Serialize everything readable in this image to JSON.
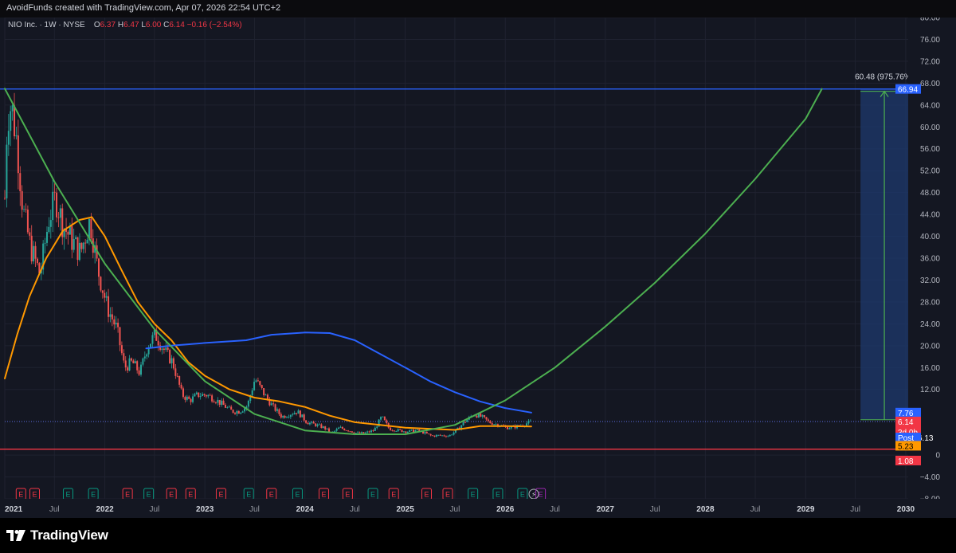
{
  "header": {
    "attribution": "AvoidFunds created with TradingView.com, Apr 07, 2026 22:54 UTC+2"
  },
  "legend": {
    "symbol": "NIO Inc. · 1W · NYSE",
    "open_label": "O",
    "open": "6.37",
    "high_label": "H",
    "high": "6.47",
    "low_label": "L",
    "low": "6.00",
    "close_label": "C",
    "close": "6.14",
    "change": "−0.16 (−2.54%)"
  },
  "footer": {
    "brand": "TradingView"
  },
  "colors": {
    "background": "#141722",
    "grid": "#1f2230",
    "candle_up": "#26a69a",
    "candle_down": "#ef5350",
    "ma_orange": "#ff9800",
    "ma_blue": "#2962ff",
    "parabola_green": "#4caf50",
    "level_blue": "#2962ff",
    "level_red": "#f23645",
    "projection_box": "#1e3a6e",
    "earnings_red": "#f23645",
    "earnings_green": "#089981",
    "upcoming_purple": "#9c27b0"
  },
  "chart_data": {
    "type": "candlestick",
    "symbol": "NIO Inc.",
    "interval": "1W",
    "exchange": "NYSE",
    "y_axis": {
      "min": -8,
      "max": 80,
      "ticks": [
        "80.00",
        "76.00",
        "72.00",
        "68.00",
        "64.00",
        "60.00",
        "56.00",
        "52.00",
        "48.00",
        "44.00",
        "40.00",
        "36.00",
        "32.00",
        "28.00",
        "24.00",
        "20.00",
        "16.00",
        "12.00",
        "0",
        "−4.00",
        "−8.00"
      ]
    },
    "x_axis": {
      "range": [
        "2021-01-01",
        "2030-01-10"
      ],
      "ticks": [
        {
          "label": "2021",
          "date": "2021-01-01",
          "bold": true
        },
        {
          "label": "Jul",
          "date": "2021-07-01",
          "bold": false
        },
        {
          "label": "2022",
          "date": "2022-01-01",
          "bold": true
        },
        {
          "label": "Jul",
          "date": "2022-07-01",
          "bold": false
        },
        {
          "label": "2023",
          "date": "2023-01-01",
          "bold": true
        },
        {
          "label": "Jul",
          "date": "2023-07-01",
          "bold": false
        },
        {
          "label": "2024",
          "date": "2024-01-01",
          "bold": true
        },
        {
          "label": "Jul",
          "date": "2024-07-01",
          "bold": false
        },
        {
          "label": "2025",
          "date": "2025-01-01",
          "bold": true
        },
        {
          "label": "Jul",
          "date": "2025-07-01",
          "bold": false
        },
        {
          "label": "2026",
          "date": "2026-01-01",
          "bold": true
        },
        {
          "label": "Jul",
          "date": "2026-07-01",
          "bold": false
        },
        {
          "label": "2027",
          "date": "2027-01-01",
          "bold": true
        },
        {
          "label": "Jul",
          "date": "2027-07-01",
          "bold": false
        },
        {
          "label": "2028",
          "date": "2028-01-01",
          "bold": true
        },
        {
          "label": "Jul",
          "date": "2028-07-01",
          "bold": false
        },
        {
          "label": "2029",
          "date": "2029-01-01",
          "bold": true
        },
        {
          "label": "Jul",
          "date": "2029-07-01",
          "bold": false
        },
        {
          "label": "2030",
          "date": "2030-01-01",
          "bold": true
        }
      ]
    },
    "price_path": [
      {
        "date": "2021-01-01",
        "price": 47
      },
      {
        "date": "2021-01-10",
        "price": 62
      },
      {
        "date": "2021-01-25",
        "price": 64
      },
      {
        "date": "2021-02-15",
        "price": 57
      },
      {
        "date": "2021-03-08",
        "price": 45
      },
      {
        "date": "2021-04-05",
        "price": 38
      },
      {
        "date": "2021-05-10",
        "price": 33
      },
      {
        "date": "2021-06-10",
        "price": 43
      },
      {
        "date": "2021-07-05",
        "price": 47
      },
      {
        "date": "2021-08-02",
        "price": 42
      },
      {
        "date": "2021-09-06",
        "price": 39
      },
      {
        "date": "2021-10-04",
        "price": 37
      },
      {
        "date": "2021-11-08",
        "price": 43
      },
      {
        "date": "2021-12-06",
        "price": 34
      },
      {
        "date": "2022-01-10",
        "price": 27
      },
      {
        "date": "2022-02-14",
        "price": 23
      },
      {
        "date": "2022-03-14",
        "price": 16
      },
      {
        "date": "2022-04-11",
        "price": 17
      },
      {
        "date": "2022-05-09",
        "price": 15
      },
      {
        "date": "2022-06-06",
        "price": 20
      },
      {
        "date": "2022-07-04",
        "price": 22
      },
      {
        "date": "2022-08-08",
        "price": 19
      },
      {
        "date": "2022-09-05",
        "price": 17
      },
      {
        "date": "2022-10-10",
        "price": 11
      },
      {
        "date": "2022-11-07",
        "price": 10
      },
      {
        "date": "2022-12-05",
        "price": 11
      },
      {
        "date": "2023-01-09",
        "price": 11
      },
      {
        "date": "2023-02-13",
        "price": 10
      },
      {
        "date": "2023-03-13",
        "price": 9
      },
      {
        "date": "2023-04-10",
        "price": 8
      },
      {
        "date": "2023-05-08",
        "price": 8
      },
      {
        "date": "2023-06-05",
        "price": 9
      },
      {
        "date": "2023-07-03",
        "price": 14
      },
      {
        "date": "2023-08-07",
        "price": 11
      },
      {
        "date": "2023-09-04",
        "price": 9
      },
      {
        "date": "2023-10-09",
        "price": 7
      },
      {
        "date": "2023-11-06",
        "price": 7.5
      },
      {
        "date": "2023-12-04",
        "price": 8
      },
      {
        "date": "2024-01-08",
        "price": 6
      },
      {
        "date": "2024-02-12",
        "price": 5.5
      },
      {
        "date": "2024-03-11",
        "price": 5
      },
      {
        "date": "2024-04-08",
        "price": 4
      },
      {
        "date": "2024-05-06",
        "price": 5
      },
      {
        "date": "2024-06-10",
        "price": 4.5
      },
      {
        "date": "2024-07-08",
        "price": 4
      },
      {
        "date": "2024-08-05",
        "price": 4
      },
      {
        "date": "2024-09-09",
        "price": 4.5
      },
      {
        "date": "2024-10-07",
        "price": 7
      },
      {
        "date": "2024-11-04",
        "price": 4.8
      },
      {
        "date": "2024-12-09",
        "price": 4.5
      },
      {
        "date": "2025-01-06",
        "price": 4.3
      },
      {
        "date": "2025-02-10",
        "price": 4.5
      },
      {
        "date": "2025-03-10",
        "price": 4.1
      },
      {
        "date": "2025-04-07",
        "price": 3.5
      },
      {
        "date": "2025-05-05",
        "price": 3.6
      },
      {
        "date": "2025-06-09",
        "price": 3.5
      },
      {
        "date": "2025-07-07",
        "price": 4.5
      },
      {
        "date": "2025-08-04",
        "price": 6
      },
      {
        "date": "2025-09-08",
        "price": 7.5
      },
      {
        "date": "2025-10-06",
        "price": 7
      },
      {
        "date": "2025-11-03",
        "price": 6
      },
      {
        "date": "2025-12-08",
        "price": 5.5
      },
      {
        "date": "2026-01-05",
        "price": 5
      },
      {
        "date": "2026-02-09",
        "price": 5.2
      },
      {
        "date": "2026-03-09",
        "price": 5.6
      },
      {
        "date": "2026-04-06",
        "price": 6.14
      }
    ],
    "series": [
      {
        "name": "",
        "color_key": "ma_orange",
        "points": [
          {
            "date": "2021-01-01",
            "price": 14
          },
          {
            "date": "2021-02-15",
            "price": 22
          },
          {
            "date": "2021-04-01",
            "price": 29
          },
          {
            "date": "2021-06-01",
            "price": 36
          },
          {
            "date": "2021-08-01",
            "price": 41
          },
          {
            "date": "2021-10-01",
            "price": 43
          },
          {
            "date": "2021-11-15",
            "price": 43.5
          },
          {
            "date": "2022-01-01",
            "price": 40
          },
          {
            "date": "2022-03-01",
            "price": 34
          },
          {
            "date": "2022-05-01",
            "price": 28
          },
          {
            "date": "2022-07-01",
            "price": 24
          },
          {
            "date": "2022-09-01",
            "price": 21
          },
          {
            "date": "2022-11-01",
            "price": 17
          },
          {
            "date": "2023-01-01",
            "price": 14.5
          },
          {
            "date": "2023-04-01",
            "price": 12
          },
          {
            "date": "2023-07-01",
            "price": 10.5
          },
          {
            "date": "2023-10-01",
            "price": 9.8
          },
          {
            "date": "2024-01-01",
            "price": 8.8
          },
          {
            "date": "2024-04-01",
            "price": 7.2
          },
          {
            "date": "2024-07-01",
            "price": 6
          },
          {
            "date": "2024-10-01",
            "price": 5.5
          },
          {
            "date": "2025-01-01",
            "price": 5
          },
          {
            "date": "2025-04-01",
            "price": 4.8
          },
          {
            "date": "2025-07-01",
            "price": 4.6
          },
          {
            "date": "2025-10-01",
            "price": 5.3
          },
          {
            "date": "2026-01-01",
            "price": 5.3
          },
          {
            "date": "2026-04-06",
            "price": 5.23
          }
        ]
      },
      {
        "name": "",
        "color_key": "ma_blue",
        "points": [
          {
            "date": "2022-06-01",
            "price": 19.5
          },
          {
            "date": "2022-09-01",
            "price": 20
          },
          {
            "date": "2023-01-01",
            "price": 20.5
          },
          {
            "date": "2023-06-01",
            "price": 21
          },
          {
            "date": "2023-09-01",
            "price": 22
          },
          {
            "date": "2024-01-01",
            "price": 22.4
          },
          {
            "date": "2024-04-01",
            "price": 22.3
          },
          {
            "date": "2024-07-01",
            "price": 21
          },
          {
            "date": "2024-10-01",
            "price": 18.5
          },
          {
            "date": "2025-01-01",
            "price": 16
          },
          {
            "date": "2025-04-01",
            "price": 13.5
          },
          {
            "date": "2025-07-01",
            "price": 11.5
          },
          {
            "date": "2025-10-01",
            "price": 9.8
          },
          {
            "date": "2026-01-01",
            "price": 8.6
          },
          {
            "date": "2026-04-06",
            "price": 7.76
          }
        ]
      },
      {
        "name": "",
        "color_key": "parabola_green",
        "points": [
          {
            "date": "2021-01-01",
            "price": 67
          },
          {
            "date": "2021-07-01",
            "price": 50
          },
          {
            "date": "2022-01-01",
            "price": 35
          },
          {
            "date": "2022-07-01",
            "price": 23
          },
          {
            "date": "2023-01-01",
            "price": 13.5
          },
          {
            "date": "2023-07-01",
            "price": 7.5
          },
          {
            "date": "2024-01-01",
            "price": 4.5
          },
          {
            "date": "2024-07-01",
            "price": 3.8
          },
          {
            "date": "2025-01-01",
            "price": 3.8
          },
          {
            "date": "2025-07-01",
            "price": 5.5
          },
          {
            "date": "2026-01-01",
            "price": 10
          },
          {
            "date": "2026-07-01",
            "price": 16
          },
          {
            "date": "2027-01-01",
            "price": 23.5
          },
          {
            "date": "2027-07-01",
            "price": 31.5
          },
          {
            "date": "2028-01-01",
            "price": 40.5
          },
          {
            "date": "2028-07-01",
            "price": 50.5
          },
          {
            "date": "2029-01-01",
            "price": 61.5
          },
          {
            "date": "2029-03-01",
            "price": 66.94
          }
        ]
      }
    ],
    "horizontal_levels": [
      {
        "price": 66.94,
        "color_key": "level_blue"
      },
      {
        "price": 1.08,
        "color_key": "level_red"
      }
    ],
    "last_price_dotted": 6.14,
    "projection": {
      "start_date": "2029-07-20",
      "end_date": "2030-01-10",
      "from_price": 6.46,
      "to_price": 66.94,
      "label": "60.48 (975.76%)"
    },
    "price_labels": [
      {
        "text": "66.94",
        "price": 66.94,
        "bg": "#2962ff",
        "color": "#ffffff"
      },
      {
        "text": "7.76",
        "price": 7.76,
        "bg": "#2962ff",
        "color": "#ffffff"
      },
      {
        "text": "6.14",
        "price": 6.14,
        "bg": "#f23645",
        "color": "#ffffff",
        "sub": "3d 0h"
      },
      {
        "text": "6.13",
        "price": 3.2,
        "bg": "#2962ff",
        "color": "#ffffff",
        "prefix": "Post"
      },
      {
        "text": "5.23",
        "price": 1.7,
        "bg": "#ff9800",
        "color": "#000000"
      },
      {
        "text": "1.08",
        "price": -1.0,
        "bg": "#f23645",
        "color": "#ffffff"
      }
    ],
    "events": [
      {
        "date": "2021-03-01",
        "type": "earnings",
        "color_key": "earnings_red",
        "label": "E"
      },
      {
        "date": "2021-04-20",
        "type": "earnings",
        "color_key": "earnings_red",
        "label": "E"
      },
      {
        "date": "2021-08-20",
        "type": "earnings",
        "color_key": "earnings_green",
        "label": "E"
      },
      {
        "date": "2021-11-20",
        "type": "earnings",
        "color_key": "earnings_green",
        "label": "E"
      },
      {
        "date": "2022-03-25",
        "type": "earnings",
        "color_key": "earnings_red",
        "label": "E"
      },
      {
        "date": "2022-06-10",
        "type": "earnings",
        "color_key": "earnings_green",
        "label": "E"
      },
      {
        "date": "2022-09-01",
        "type": "earnings",
        "color_key": "earnings_red",
        "label": "E"
      },
      {
        "date": "2022-11-10",
        "type": "earnings",
        "color_key": "earnings_red",
        "label": "E"
      },
      {
        "date": "2023-03-01",
        "type": "earnings",
        "color_key": "earnings_red",
        "label": "E"
      },
      {
        "date": "2023-06-10",
        "type": "earnings",
        "color_key": "earnings_green",
        "label": "E"
      },
      {
        "date": "2023-09-01",
        "type": "earnings",
        "color_key": "earnings_red",
        "label": "E"
      },
      {
        "date": "2023-12-05",
        "type": "earnings",
        "color_key": "earnings_green",
        "label": "E"
      },
      {
        "date": "2024-03-10",
        "type": "earnings",
        "color_key": "earnings_red",
        "label": "E"
      },
      {
        "date": "2024-06-05",
        "type": "earnings",
        "color_key": "earnings_red",
        "label": "E"
      },
      {
        "date": "2024-09-05",
        "type": "earnings",
        "color_key": "earnings_green",
        "label": "E"
      },
      {
        "date": "2024-11-20",
        "type": "earnings",
        "color_key": "earnings_red",
        "label": "E"
      },
      {
        "date": "2025-03-20",
        "type": "earnings",
        "color_key": "earnings_red",
        "label": "E"
      },
      {
        "date": "2025-06-05",
        "type": "earnings",
        "color_key": "earnings_red",
        "label": "E"
      },
      {
        "date": "2025-09-05",
        "type": "earnings",
        "color_key": "earnings_green",
        "label": "E"
      },
      {
        "date": "2025-12-05",
        "type": "earnings",
        "color_key": "earnings_green",
        "label": "E"
      },
      {
        "date": "2026-03-05",
        "type": "earnings",
        "color_key": "earnings_green",
        "label": "E"
      },
      {
        "date": "2026-04-15",
        "type": "split",
        "color_key": "upcoming_purple",
        "label": "⚡"
      },
      {
        "date": "2026-05-10",
        "type": "upcoming",
        "color_key": "upcoming_purple",
        "label": "E"
      }
    ]
  }
}
